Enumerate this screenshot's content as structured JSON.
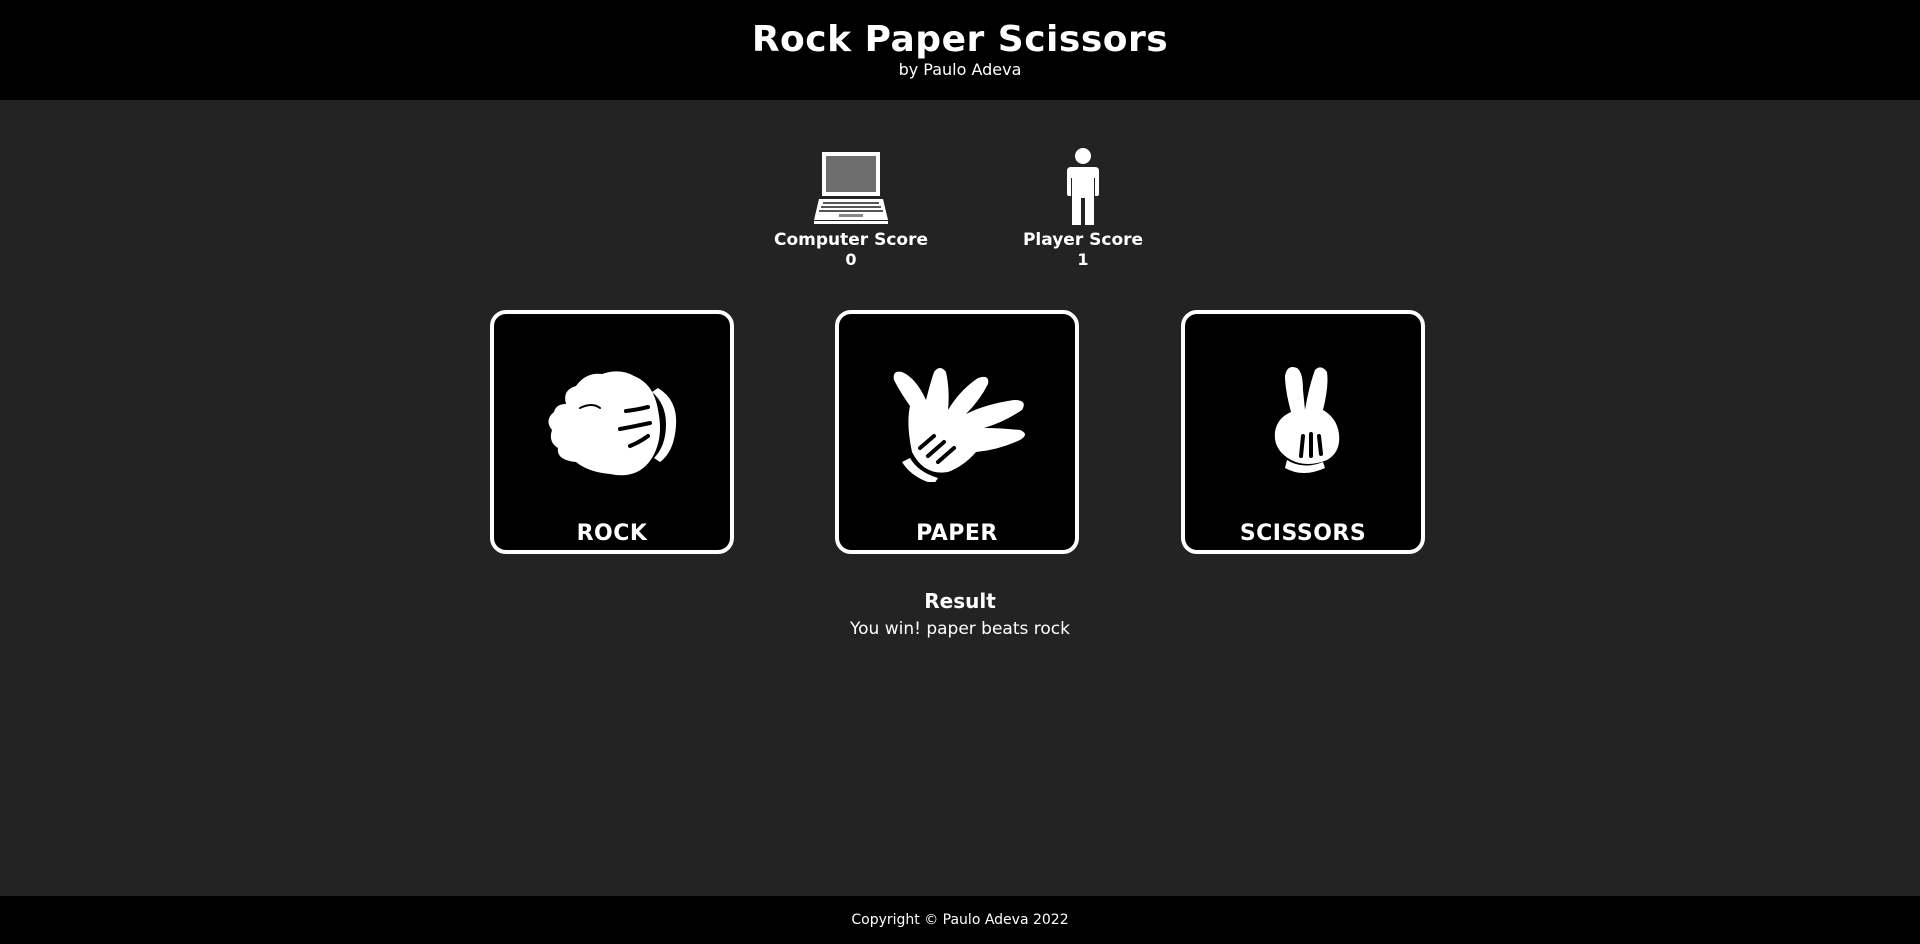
{
  "header": {
    "title": "Rock Paper Scissors",
    "subtitle": "by Paulo Adeva"
  },
  "scores": {
    "computer": {
      "label": "Computer Score",
      "value": "0",
      "icon": "laptop-icon"
    },
    "player": {
      "label": "Player Score",
      "value": "1",
      "icon": "person-icon"
    }
  },
  "choices": [
    {
      "label": "ROCK",
      "icon": "fist-hand-icon"
    },
    {
      "label": "PAPER",
      "icon": "open-hand-icon"
    },
    {
      "label": "SCISSORS",
      "icon": "peace-hand-icon"
    }
  ],
  "result": {
    "heading": "Result",
    "text": "You win! paper beats rock"
  },
  "footer": {
    "copyright": "Copyright © Paulo Adeva 2022"
  },
  "colors": {
    "background": "#232323",
    "bar": "#000000",
    "text": "#ffffff"
  }
}
